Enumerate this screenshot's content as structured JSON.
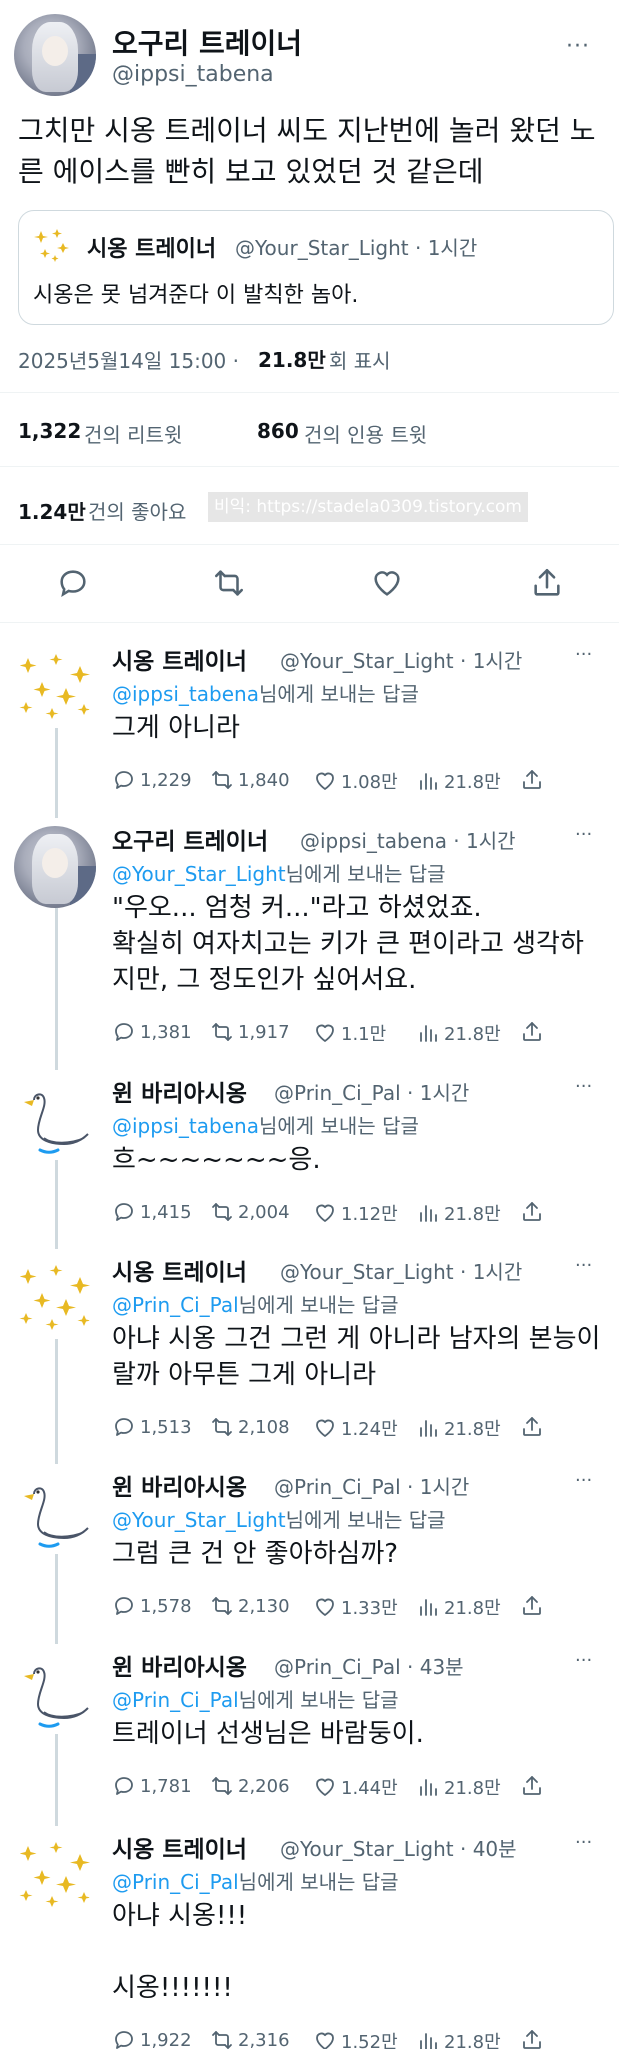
{
  "main": {
    "name": "오구리 트레이너",
    "handle": "@ippsi_tabena",
    "more": "···",
    "text": "그치만 시옹 트레이너 씨도 지난번에 놀러 왔던 노른 에이스를 빤히 보고 있었던 것 같은데",
    "quote": {
      "name": "시옹 트레이너",
      "handle": "@Your_Star_Light · 1시간",
      "text": "시옹은 못 넘겨준다 이 발칙한 놈아."
    },
    "time": "2025년5월14일  15:00 · ",
    "views_num": "21.8만",
    "views_label": " 회 표시",
    "retweets_num": "1,322",
    "retweets_label": "건의 리트윗",
    "quotes_num": "860",
    "quotes_label": "건의 인용 트윗",
    "likes_num": "1.24만",
    "likes_label": "건의 좋아요",
    "watermark": "비익: https://stadela0309.tistory.com"
  },
  "replies": [
    {
      "name": "시옹 트레이너",
      "handle": "@Your_Star_Light · 1시간",
      "mention": "@ippsi_tabena",
      "reply_suffix": "님에게 보내는 답글",
      "text": "그게 아니라",
      "comments": "1,229",
      "retweets": "1,840",
      "likes": "1.08만",
      "views": "21.8만"
    },
    {
      "name": "오구리 트레이너",
      "handle": "@ippsi_tabena · 1시간",
      "mention": "@Your_Star_Light",
      "reply_suffix": "님에게 보내는 답글",
      "text": "\"우오... 엄청 커...\"라고 하셨었죠.\n확실히 여자치고는 키가 큰 편이라고 생각하지만, 그 정도인가 싶어서요.",
      "comments": "1,381",
      "retweets": "1,917",
      "likes": "1.1만",
      "views": "21.8만"
    },
    {
      "name": "윈 바리아시옹",
      "handle": "@Prin_Ci_Pal · 1시간",
      "mention": "@ippsi_tabena",
      "reply_suffix": "님에게 보내는 답글",
      "text": "흐~~~~~~~응.",
      "comments": "1,415",
      "retweets": "2,004",
      "likes": "1.12만",
      "views": "21.8만"
    },
    {
      "name": "시옹 트레이너",
      "handle": "@Your_Star_Light · 1시간",
      "mention": "@Prin_Ci_Pal",
      "reply_suffix": "님에게 보내는 답글",
      "text": "아냐 시옹 그건 그런 게 아니라 남자의 본능이랄까 아무튼 그게 아니라",
      "comments": "1,513",
      "retweets": "2,108",
      "likes": "1.24만",
      "views": "21.8만"
    },
    {
      "name": "윈 바리아시옹",
      "handle": "@Prin_Ci_Pal · 1시간",
      "mention": "@Your_Star_Light",
      "reply_suffix": "님에게 보내는 답글",
      "text": "그럼 큰 건 안 좋아하심까?",
      "comments": "1,578",
      "retweets": "2,130",
      "likes": "1.33만",
      "views": "21.8만"
    },
    {
      "name": "윈 바리아시옹",
      "handle": "@Prin_Ci_Pal · 43분",
      "mention": "@Prin_Ci_Pal",
      "reply_suffix": "님에게 보내는 답글",
      "text": "트레이너 선생님은 바람둥이.",
      "comments": "1,781",
      "retweets": "2,206",
      "likes": "1.44만",
      "views": "21.8만"
    },
    {
      "name": "시옹 트레이너",
      "handle": "@Your_Star_Light · 40분",
      "mention": "@Prin_Ci_Pal",
      "reply_suffix": "님에게 보내는 답글",
      "text": "아냐 시옹!!!\n\n시옹!!!!!!!",
      "comments": "1,922",
      "retweets": "2,316",
      "likes": "1.52만",
      "views": "21.8만"
    }
  ],
  "colors": {
    "link": "#1d9bf0",
    "muted": "#536471",
    "text": "#0f1419",
    "divider": "#eff3f4"
  },
  "icons": [
    "comment-icon",
    "retweet-icon",
    "like-icon",
    "views-icon",
    "share-icon",
    "more-icon"
  ]
}
